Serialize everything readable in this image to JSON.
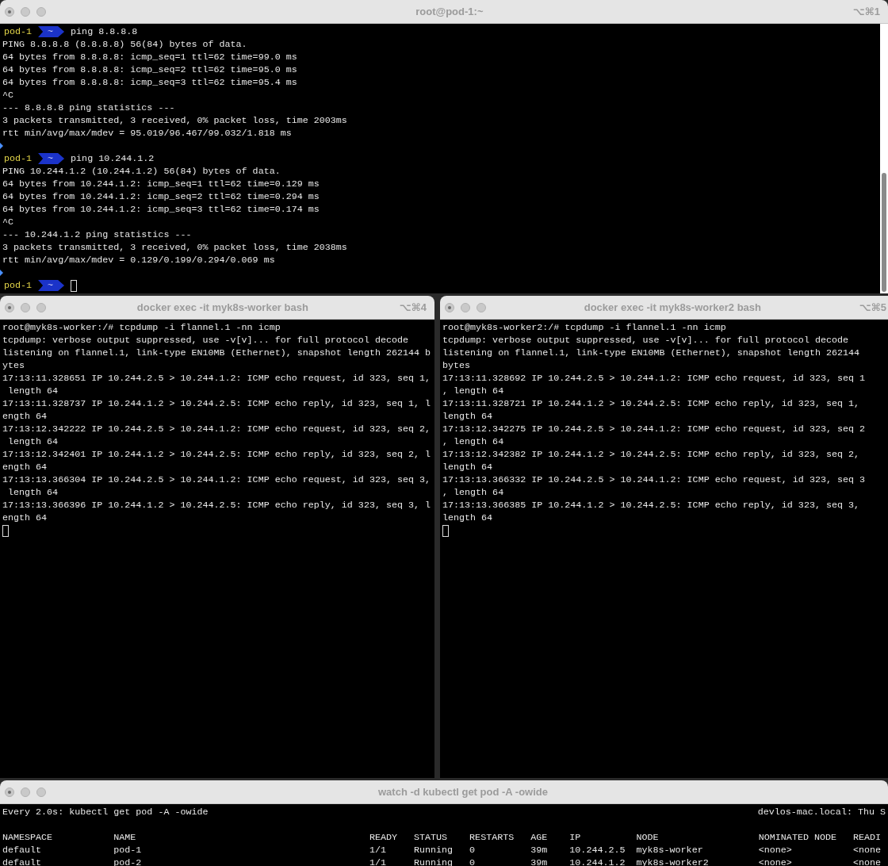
{
  "windows": [
    {
      "kind": "shell",
      "title": "root@pod-1:~",
      "shortcut": "⌥⌘1",
      "scrollbar": true,
      "lines": [
        {
          "kind": "prompt",
          "host": "pod-1",
          "dir": "~",
          "command": "ping 8.8.8.8"
        },
        {
          "kind": "output",
          "text": "PING 8.8.8.8 (8.8.8.8) 56(84) bytes of data."
        },
        {
          "kind": "output",
          "text": "64 bytes from 8.8.8.8: icmp_seq=1 ttl=62 time=99.0 ms"
        },
        {
          "kind": "output",
          "text": "64 bytes from 8.8.8.8: icmp_seq=2 ttl=62 time=95.0 ms"
        },
        {
          "kind": "output",
          "text": "64 bytes from 8.8.8.8: icmp_seq=3 ttl=62 time=95.4 ms"
        },
        {
          "kind": "output",
          "text": "^C"
        },
        {
          "kind": "output",
          "text": "--- 8.8.8.8 ping statistics ---"
        },
        {
          "kind": "output",
          "text": "3 packets transmitted, 3 received, 0% packet loss, time 2003ms"
        },
        {
          "kind": "output",
          "text": "rtt min/avg/max/mdev = 95.019/96.467/99.032/1.818 ms"
        },
        {
          "kind": "mark"
        },
        {
          "kind": "prompt",
          "host": "pod-1",
          "dir": "~",
          "command": "ping 10.244.1.2"
        },
        {
          "kind": "output",
          "text": "PING 10.244.1.2 (10.244.1.2) 56(84) bytes of data."
        },
        {
          "kind": "output",
          "text": "64 bytes from 10.244.1.2: icmp_seq=1 ttl=62 time=0.129 ms"
        },
        {
          "kind": "output",
          "text": "64 bytes from 10.244.1.2: icmp_seq=2 ttl=62 time=0.294 ms"
        },
        {
          "kind": "output",
          "text": "64 bytes from 10.244.1.2: icmp_seq=3 ttl=62 time=0.174 ms"
        },
        {
          "kind": "output",
          "text": "^C"
        },
        {
          "kind": "output",
          "text": "--- 10.244.1.2 ping statistics ---"
        },
        {
          "kind": "output",
          "text": "3 packets transmitted, 3 received, 0% packet loss, time 2038ms"
        },
        {
          "kind": "output",
          "text": "rtt min/avg/max/mdev = 0.129/0.199/0.294/0.069 ms"
        },
        {
          "kind": "mark"
        },
        {
          "kind": "prompt",
          "host": "pod-1",
          "dir": "~",
          "cursor": true
        }
      ]
    },
    {
      "kind": "shell",
      "title": "docker exec -it myk8s-worker bash",
      "shortcut": "⌥⌘4",
      "lines": [
        {
          "kind": "output",
          "text": "root@myk8s-worker:/# tcpdump -i flannel.1 -nn icmp"
        },
        {
          "kind": "output",
          "text": "tcpdump: verbose output suppressed, use -v[v]... for full protocol decode"
        },
        {
          "kind": "output",
          "text": "listening on flannel.1, link-type EN10MB (Ethernet), snapshot length 262144 b"
        },
        {
          "kind": "output",
          "text": "ytes"
        },
        {
          "kind": "output",
          "text": "17:13:11.328651 IP 10.244.2.5 > 10.244.1.2: ICMP echo request, id 323, seq 1,"
        },
        {
          "kind": "output",
          "text": " length 64"
        },
        {
          "kind": "output",
          "text": "17:13:11.328737 IP 10.244.1.2 > 10.244.2.5: ICMP echo reply, id 323, seq 1, l"
        },
        {
          "kind": "output",
          "text": "ength 64"
        },
        {
          "kind": "output",
          "text": "17:13:12.342222 IP 10.244.2.5 > 10.244.1.2: ICMP echo request, id 323, seq 2,"
        },
        {
          "kind": "output",
          "text": " length 64"
        },
        {
          "kind": "output",
          "text": "17:13:12.342401 IP 10.244.1.2 > 10.244.2.5: ICMP echo reply, id 323, seq 2, l"
        },
        {
          "kind": "output",
          "text": "ength 64"
        },
        {
          "kind": "output",
          "text": "17:13:13.366304 IP 10.244.2.5 > 10.244.1.2: ICMP echo request, id 323, seq 3,"
        },
        {
          "kind": "output",
          "text": " length 64"
        },
        {
          "kind": "output",
          "text": "17:13:13.366396 IP 10.244.1.2 > 10.244.2.5: ICMP echo reply, id 323, seq 3, l"
        },
        {
          "kind": "output",
          "text": "ength 64"
        },
        {
          "kind": "cursor"
        }
      ]
    },
    {
      "kind": "shell",
      "title": "docker exec -it myk8s-worker2 bash",
      "shortcut": "⌥⌘5",
      "lines": [
        {
          "kind": "output",
          "text": "root@myk8s-worker2:/# tcpdump -i flannel.1 -nn icmp"
        },
        {
          "kind": "output",
          "text": "tcpdump: verbose output suppressed, use -v[v]... for full protocol decode"
        },
        {
          "kind": "output",
          "text": "listening on flannel.1, link-type EN10MB (Ethernet), snapshot length 262144"
        },
        {
          "kind": "output",
          "text": "bytes"
        },
        {
          "kind": "output",
          "text": "17:13:11.328692 IP 10.244.2.5 > 10.244.1.2: ICMP echo request, id 323, seq 1"
        },
        {
          "kind": "output",
          "text": ", length 64"
        },
        {
          "kind": "output",
          "text": "17:13:11.328721 IP 10.244.1.2 > 10.244.2.5: ICMP echo reply, id 323, seq 1,"
        },
        {
          "kind": "output",
          "text": "length 64"
        },
        {
          "kind": "output",
          "text": "17:13:12.342275 IP 10.244.2.5 > 10.244.1.2: ICMP echo request, id 323, seq 2"
        },
        {
          "kind": "output",
          "text": ", length 64"
        },
        {
          "kind": "output",
          "text": "17:13:12.342382 IP 10.244.1.2 > 10.244.2.5: ICMP echo reply, id 323, seq 2,"
        },
        {
          "kind": "output",
          "text": "length 64"
        },
        {
          "kind": "output",
          "text": "17:13:13.366332 IP 10.244.2.5 > 10.244.1.2: ICMP echo request, id 323, seq 3"
        },
        {
          "kind": "output",
          "text": ", length 64"
        },
        {
          "kind": "output",
          "text": "17:13:13.366385 IP 10.244.1.2 > 10.244.2.5: ICMP echo reply, id 323, seq 3,"
        },
        {
          "kind": "output",
          "text": "length 64"
        },
        {
          "kind": "cursor"
        }
      ]
    },
    {
      "kind": "watch",
      "title": "watch -d kubectl get pod -A -owide",
      "header": "Every 2.0s: kubectl get pod -A -owide",
      "host": "devlos-mac.local: Thu S",
      "table": {
        "columns": [
          "NAMESPACE",
          "NAME",
          "READY",
          "STATUS",
          "RESTARTS",
          "AGE",
          "IP",
          "NODE",
          "NOMINATED NODE",
          "READI"
        ],
        "rows": [
          [
            "default",
            "pod-1",
            "1/1",
            "Running",
            "0",
            "39m",
            "10.244.2.5",
            "myk8s-worker",
            "<none>",
            "<none"
          ],
          [
            "default",
            "pod-2",
            "1/1",
            "Running",
            "0",
            "39m",
            "10.244.1.2",
            "myk8s-worker2",
            "<none>",
            "<none"
          ]
        ]
      }
    }
  ]
}
